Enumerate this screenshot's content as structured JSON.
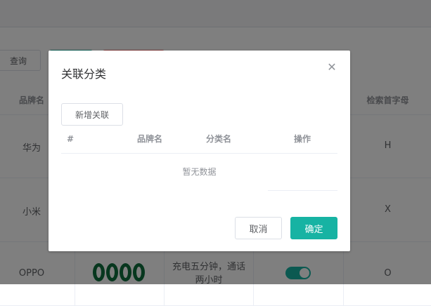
{
  "toolbar": {
    "query_label": "查询"
  },
  "table": {
    "headers": {
      "brand_name": "品牌名",
      "first_letter": "检索首字母"
    },
    "rows": [
      {
        "brand": "华为",
        "letter": "H"
      },
      {
        "brand": "小米",
        "letter": "X"
      },
      {
        "brand": "OPPO",
        "letter": "O",
        "description": "充电五分钟，通话两小时",
        "show_status": true
      }
    ]
  },
  "dialog": {
    "title": "关联分类",
    "new_button": "新增关联",
    "columns": {
      "index": "#",
      "brand_name": "品牌名",
      "category_name": "分类名",
      "actions": "操作"
    },
    "empty_text": "暂无数据",
    "cancel": "取消",
    "confirm": "确定"
  },
  "colors": {
    "primary": "#17b3a3",
    "danger": "#f56c6c",
    "logo_green": "#0f6f3d"
  },
  "icons": {
    "close": "close-icon",
    "oppo_logo": "oppo-logo"
  }
}
